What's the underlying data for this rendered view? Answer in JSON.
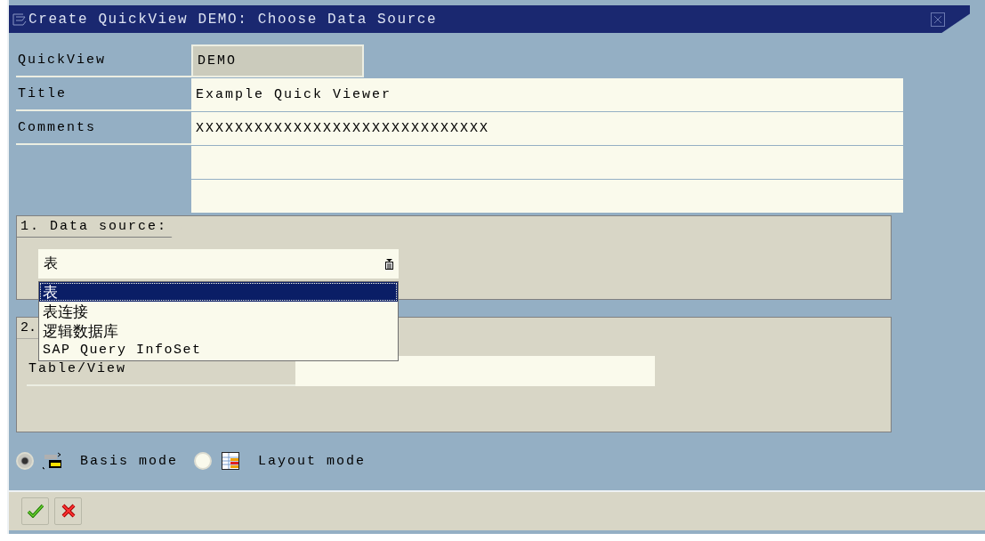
{
  "window": {
    "title": "Create QuickView DEMO: Choose Data Source"
  },
  "fields": [
    {
      "label": "QuickView",
      "value": "DEMO",
      "disabled": true
    },
    {
      "label": "Title",
      "value": "Example Quick Viewer",
      "disabled": false
    },
    {
      "label": "Comments",
      "value": "XXXXXXXXXXXXXXXXXXXXXXXXXXXXXX",
      "disabled": false
    },
    {
      "disabled": false
    },
    {
      "disabled": false
    }
  ],
  "data_source": {
    "title": "1. Data source:",
    "value": "表",
    "options": [
      {
        "label": "表",
        "selected": true
      },
      {
        "label": "表连接",
        "selected": false
      },
      {
        "label": "逻辑数据库",
        "selected": false
      },
      {
        "label": "SAP Query InfoSet",
        "selected": false
      }
    ]
  },
  "table_group": {
    "title": "2.",
    "field_label": "Table/View"
  },
  "modes": [
    {
      "kind": "basis",
      "label": "Basis mode",
      "selected": true
    },
    {
      "kind": "layout",
      "label": "Layout mode",
      "selected": false
    }
  ],
  "buttons": [
    {
      "kind": "confirm"
    },
    {
      "kind": "cancel"
    }
  ]
}
